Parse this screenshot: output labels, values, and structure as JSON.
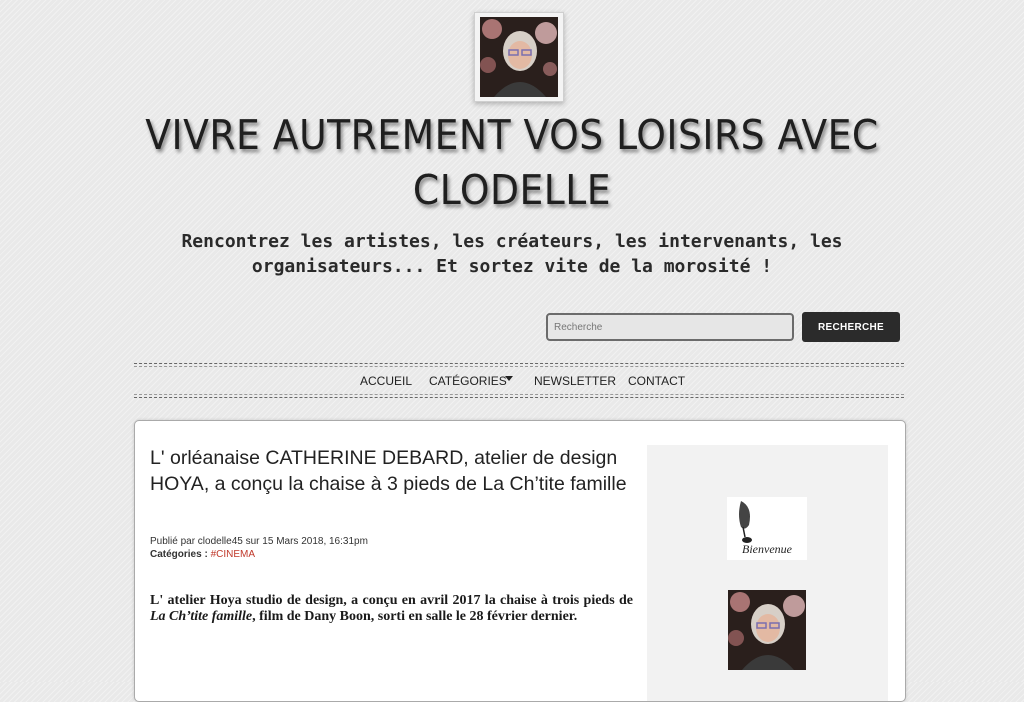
{
  "header": {
    "title": "VIVRE AUTREMENT VOS LOISIRS AVEC CLODELLE",
    "subtitle": "Rencontrez les artistes, les créateurs, les intervenants, les organisateurs... Et sortez vite de la morosité !"
  },
  "search": {
    "placeholder": "Recherche",
    "button_label": "RECHERCHE"
  },
  "nav": {
    "items": [
      {
        "label": "ACCUEIL"
      },
      {
        "label": "CATÉGORIES"
      },
      {
        "label": "NEWSLETTER"
      },
      {
        "label": "CONTACT"
      }
    ]
  },
  "article": {
    "title": "L' orléanaise CATHERINE DEBARD, atelier de design HOYA, a conçu la chaise à 3 pieds de La Ch’tite famille",
    "published": "Publié par clodelle45 sur 15 Mars 2018, 16:31pm",
    "categories_label": "Catégories :",
    "category": "#CINEMA",
    "body_part1": "L' atelier Hoya studio de design, a conçu en avril 2017 la chaise à trois pieds de ",
    "body_italic": "La Ch’tite famille",
    "body_part2": ", film de Dany Boon, sorti en salle le 28 février dernier."
  },
  "sidebar": {
    "welcome_text": "Bienvenue"
  },
  "colors": {
    "accent_link": "#c0392b",
    "button_bg": "#2b2b2b"
  }
}
